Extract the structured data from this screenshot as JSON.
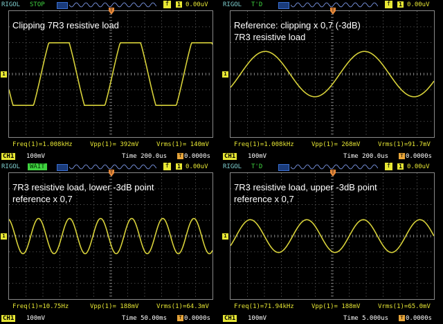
{
  "colors": {
    "trace": "#d8d23a",
    "grid": "#7a7a7a",
    "caption": "#ffffff",
    "accent": "#e7e734",
    "state": "#3fd23f"
  },
  "panels": [
    {
      "brand": "RIGOL",
      "state": "STOP",
      "state_style": "plain",
      "trig_mark": "f",
      "trig_ch": "1",
      "trig_val": "0.00uV",
      "caption": "Clipping 7R3 resistive load",
      "freq": "Freq(1)=1.008kHz",
      "vpp": "Vpp(1)= 392mV",
      "vrms": "Vrms(1)= 140mV",
      "ch": "CH1",
      "volts": "100mV",
      "time": "Time 200.0us",
      "tdel": "0.0000s",
      "wave": {
        "cycles": 2.85,
        "amplitude": 0.8,
        "clip": 0.62,
        "phase": 0.55
      }
    },
    {
      "brand": "RIGOL",
      "state": "T'D",
      "state_style": "plain",
      "trig_mark": "f",
      "trig_ch": "1",
      "trig_val": "0.00uV",
      "caption": "Reference: clipping x 0,7 (-3dB)\n7R3 resistive load",
      "freq": "Freq(1)=1.008kHz",
      "vpp": "Vpp(1)= 268mV",
      "vrms": "Vrms(1)=91.7mV",
      "ch": "CH1",
      "volts": "100mV",
      "time": "Time 200.0us",
      "tdel": "0.0000s",
      "wave": {
        "cycles": 2.05,
        "amplitude": 0.36,
        "clip": 1.0,
        "phase": 0.9
      }
    },
    {
      "brand": "RIGOL",
      "state": "WAIT",
      "state_style": "boxed",
      "trig_mark": "f",
      "trig_ch": "1",
      "trig_val": "0.00uV",
      "caption": "7R3 resistive load, lower -3dB point\nreference x 0,7",
      "freq": "Freq(1)=10.75Hz",
      "vpp": "Vpp(1)= 188mV",
      "vrms": "Vrms(1)=64.3mV",
      "ch": "CH1",
      "volts": "100mV",
      "time": "Time 50.00ms",
      "tdel": "0.0000s",
      "wave": {
        "cycles": 6.55,
        "amplitude": 0.28,
        "clip": 1.0,
        "phase": 0.3
      }
    },
    {
      "brand": "RIGOL",
      "state": "T'D",
      "state_style": "plain",
      "trig_mark": "f",
      "trig_ch": "1",
      "trig_val": "0.00uV",
      "caption": "7R3 resistive load, upper -3dB point\nreference x 0,7",
      "freq": "Freq(1)=71.94kHz",
      "vpp": "Vpp(1)= 188mV",
      "vrms": "Vrms(1)=65.0mV",
      "ch": "CH1",
      "volts": "100mV",
      "time": "Time 5.000us",
      "tdel": "0.0000s",
      "wave": {
        "cycles": 3.6,
        "amplitude": 0.26,
        "clip": 1.0,
        "phase": 0.9
      }
    }
  ]
}
